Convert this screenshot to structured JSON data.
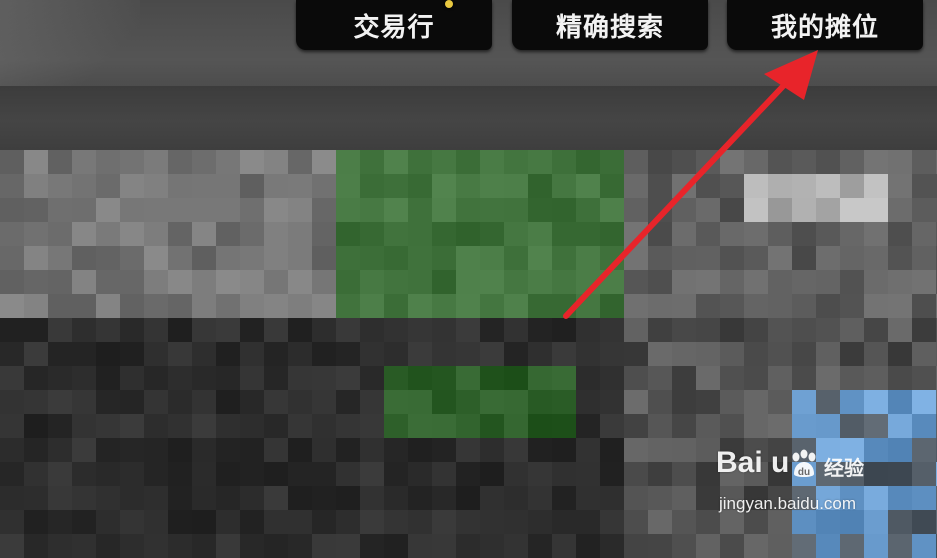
{
  "tabs": [
    {
      "label": "交易行"
    },
    {
      "label": "精确搜索"
    },
    {
      "label": "我的摊位"
    }
  ],
  "annotation": {
    "color": "#e8242a"
  },
  "watermark": {
    "brand": "Bai  u",
    "sub": "经验",
    "url": "jingyan.baidu.com"
  },
  "colors": {
    "tab_bg": "#0a0a0a",
    "tab_text": "#f2f2f2",
    "notification_dot": "#e8c840"
  }
}
